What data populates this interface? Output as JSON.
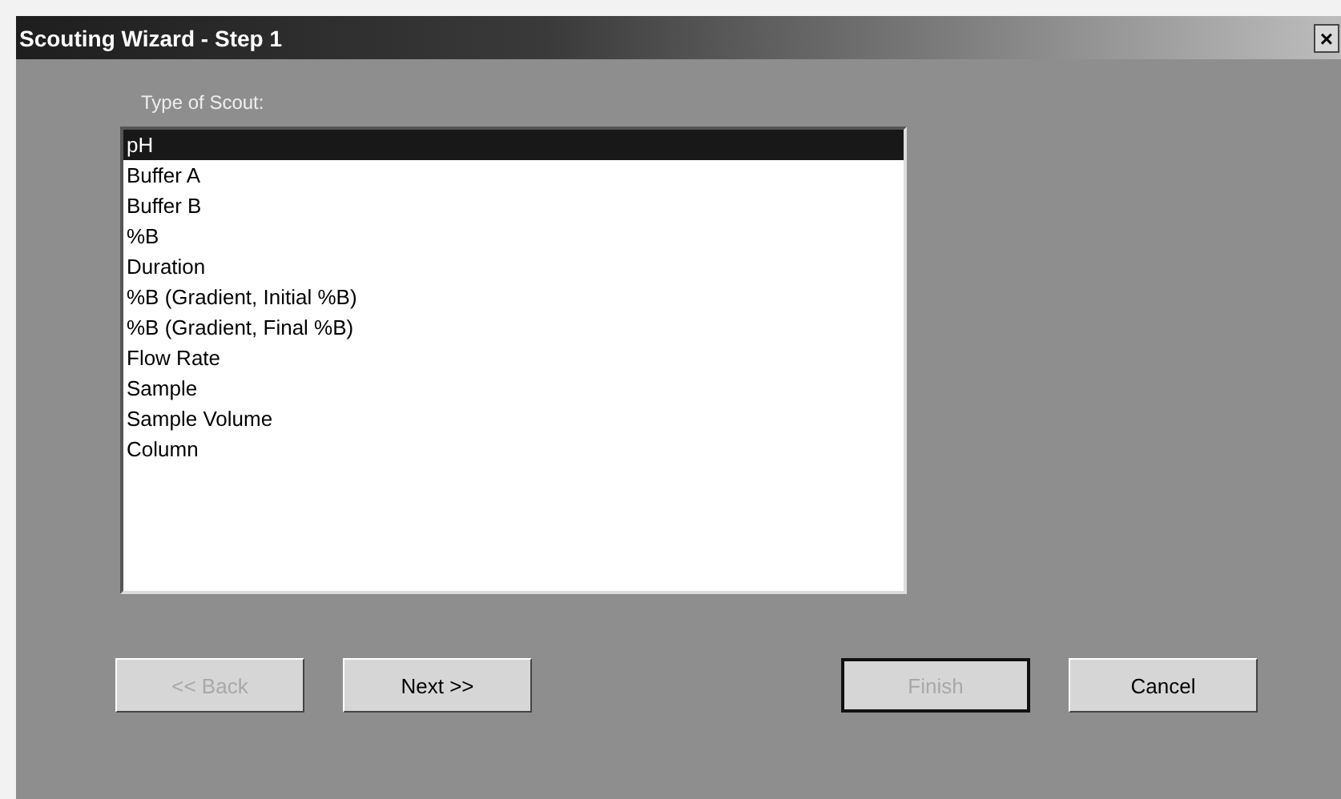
{
  "window": {
    "title": "Scouting Wizard - Step 1",
    "close": "×"
  },
  "list": {
    "label": "Type of Scout:",
    "items": [
      {
        "label": "pH",
        "selected": true
      },
      {
        "label": "Buffer A",
        "selected": false
      },
      {
        "label": "Buffer B",
        "selected": false
      },
      {
        "label": "%B",
        "selected": false
      },
      {
        "label": "Duration",
        "selected": false
      },
      {
        "label": "%B (Gradient, Initial %B)",
        "selected": false
      },
      {
        "label": "%B (Gradient, Final %B)",
        "selected": false
      },
      {
        "label": "Flow Rate",
        "selected": false
      },
      {
        "label": "Sample",
        "selected": false
      },
      {
        "label": "Sample Volume",
        "selected": false
      },
      {
        "label": "Column",
        "selected": false
      }
    ]
  },
  "buttons": [
    {
      "label": "<< Back",
      "disabled": true,
      "default": false
    },
    {
      "label": "Next >>",
      "disabled": false,
      "default": false
    },
    {
      "label": "Finish",
      "disabled": true,
      "default": true
    },
    {
      "label": "Cancel",
      "disabled": false,
      "default": false
    }
  ]
}
